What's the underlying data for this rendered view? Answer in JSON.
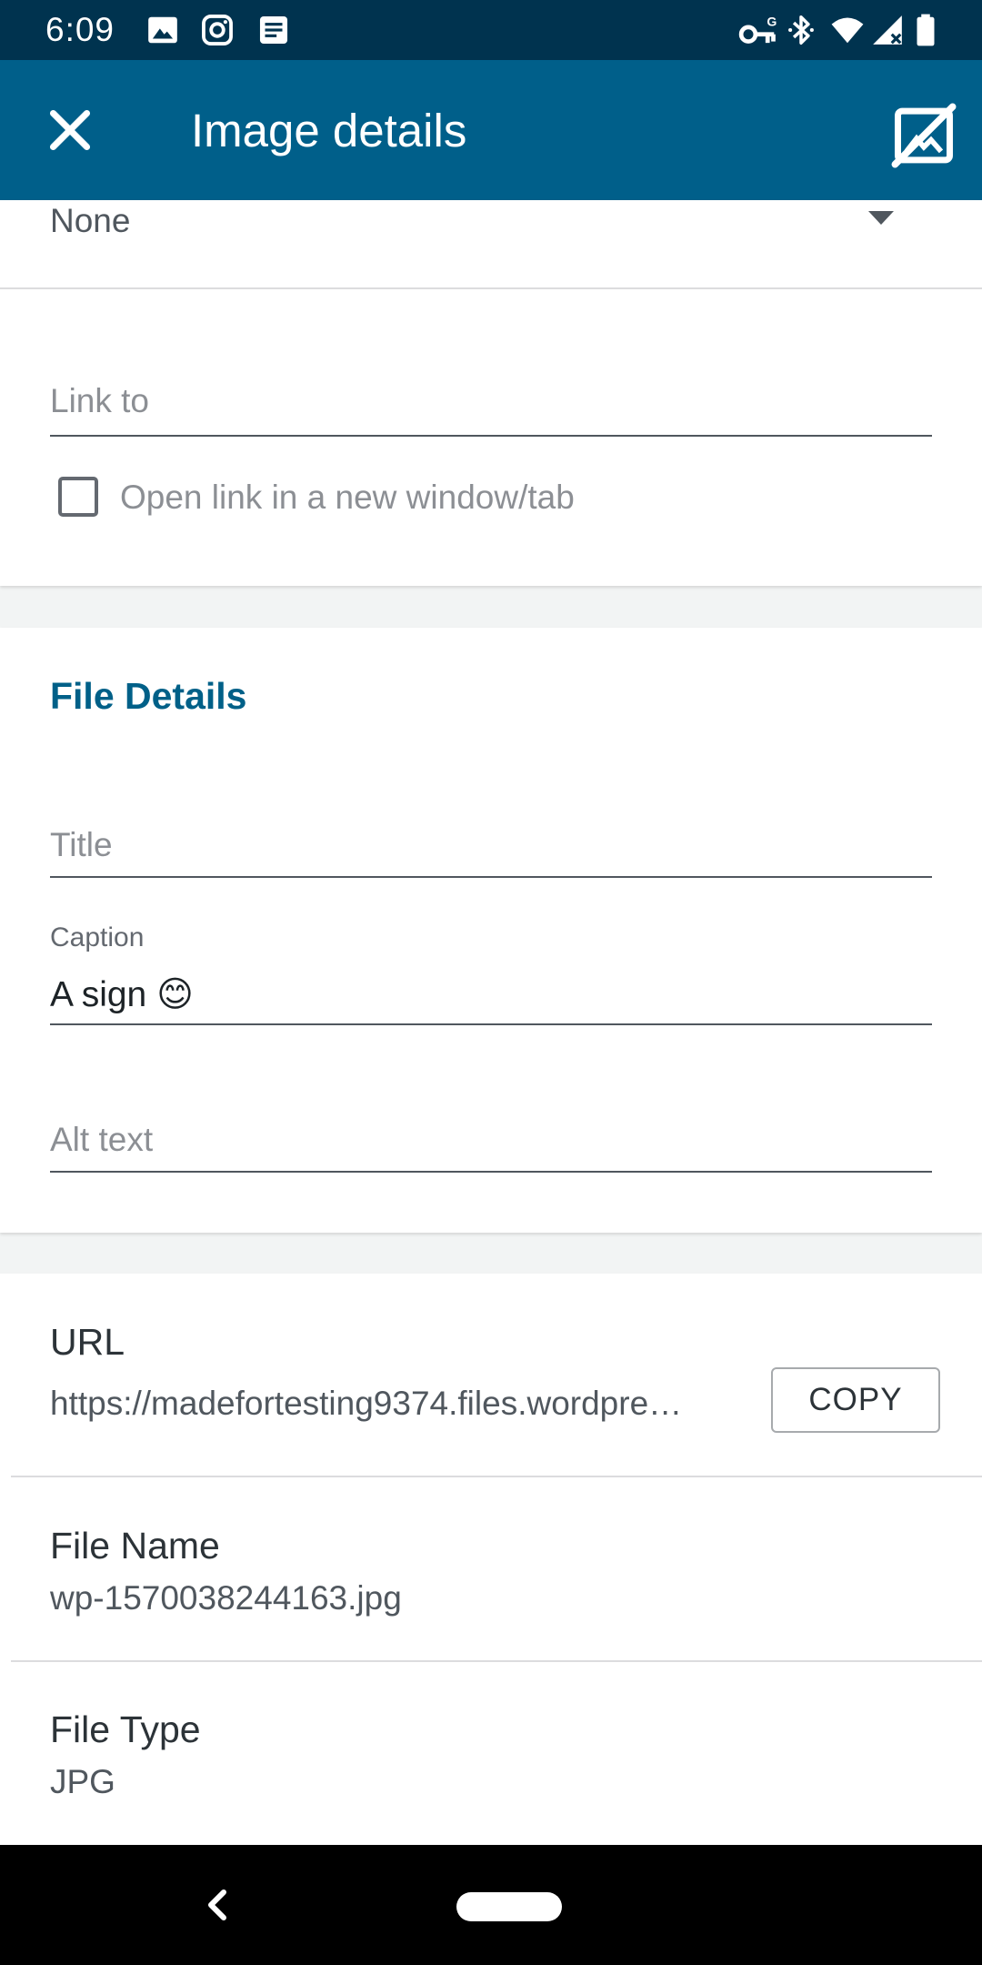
{
  "status_bar": {
    "time": "6:09",
    "left_icons": [
      "image-icon",
      "instagram-icon",
      "notes-icon"
    ],
    "right_icons": [
      "vpn-key-icon",
      "bluetooth-icon",
      "wifi-icon",
      "signal-icon",
      "battery-icon"
    ]
  },
  "app_bar": {
    "title": "Image details",
    "close_icon": "close-icon",
    "action_icon": "image-off-icon",
    "background": "#005f8a"
  },
  "link_settings": {
    "size_value": "None",
    "link_to_placeholder": "Link to",
    "open_new_window_label": "Open link in a new window/tab",
    "open_new_window_checked": false
  },
  "file_details": {
    "section_title": "File Details",
    "title_placeholder": "Title",
    "caption_label": "Caption",
    "caption_value": "A sign 😊",
    "alt_text_placeholder": "Alt text"
  },
  "info": {
    "url_title": "URL",
    "url_value": "https://madefortesting9374.files.wordpre…",
    "copy_label": "COPY",
    "file_name_title": "File Name",
    "file_name_value": "wp-1570038244163.jpg",
    "file_type_title": "File Type",
    "file_type_value": "JPG"
  },
  "colors": {
    "status_bar": "#00334f",
    "accent": "#006088"
  }
}
